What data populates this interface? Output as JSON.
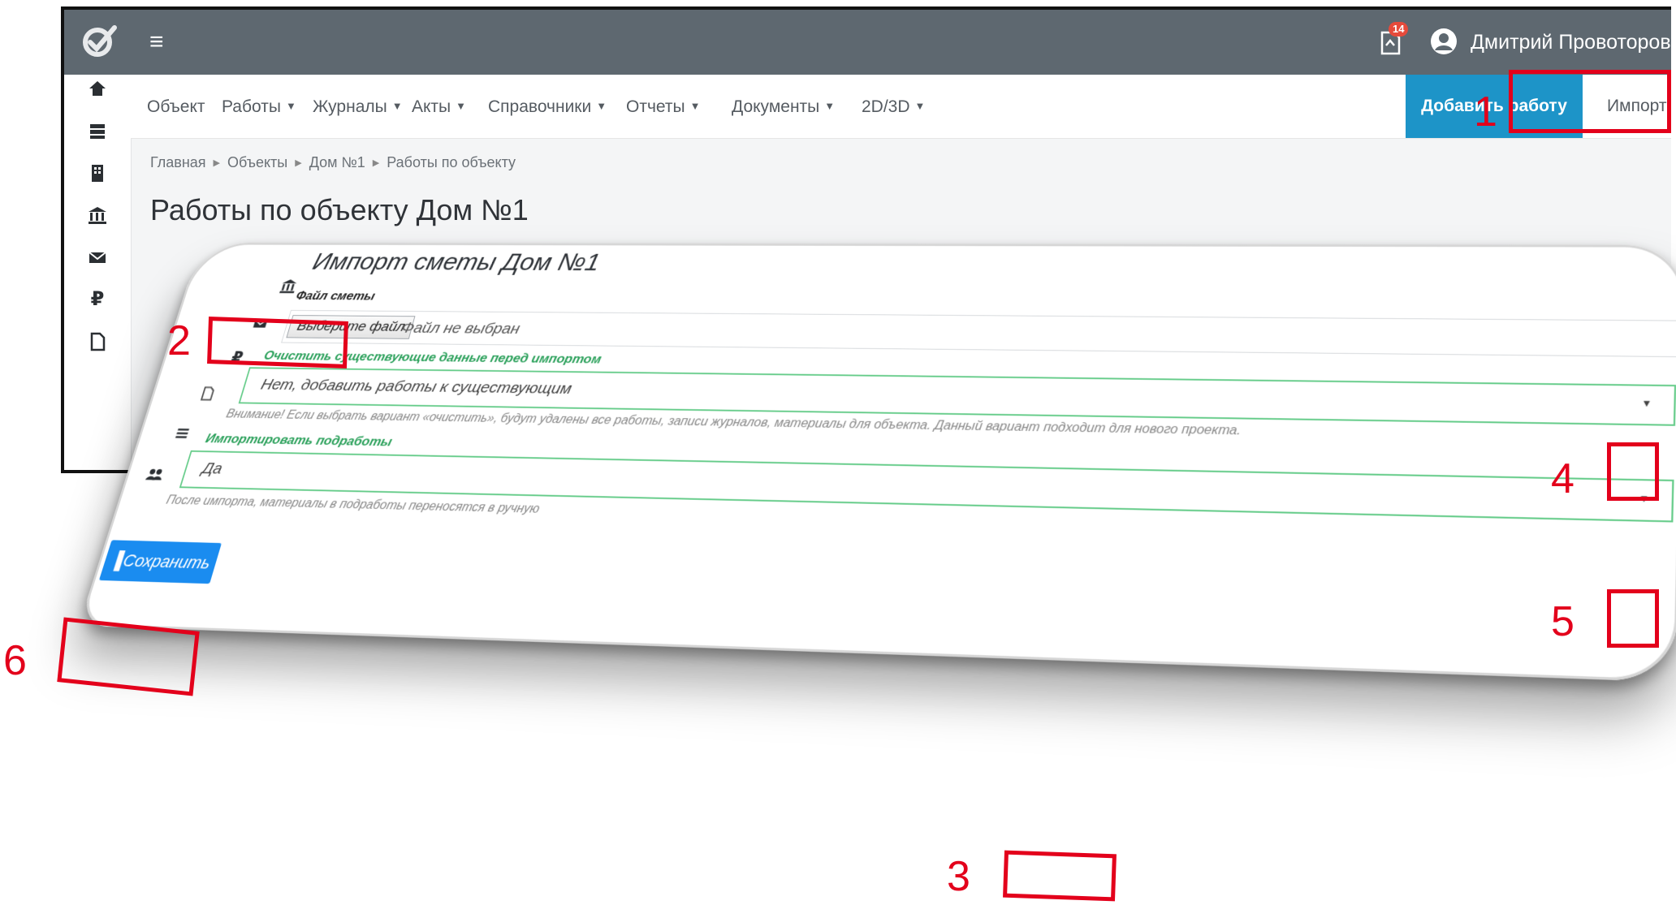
{
  "header": {
    "notification_count": "14",
    "user_name": "Дмитрий Провоторов"
  },
  "nav": {
    "items": [
      {
        "label": "Объект",
        "dropdown": false
      },
      {
        "label": "Работы",
        "dropdown": true
      },
      {
        "label": "Журналы",
        "dropdown": true
      },
      {
        "label": "Акты",
        "dropdown": true
      },
      {
        "label": "Справочники",
        "dropdown": true
      },
      {
        "label": "Отчеты",
        "dropdown": true
      },
      {
        "label": "Документы",
        "dropdown": true
      },
      {
        "label": "2D/3D",
        "dropdown": true
      }
    ],
    "add_button": "Добавить работу",
    "import_button": "Импорт сметы"
  },
  "breadcrumb": [
    "Главная",
    "Объекты",
    "Дом №1",
    "Работы по объекту"
  ],
  "page_title": "Работы по объекту Дом №1",
  "sidebar_icons": [
    "home-icon",
    "server-icon",
    "building-icon",
    "bank-icon",
    "envelope-icon",
    "ruble-icon",
    "document-icon"
  ],
  "modal": {
    "title": "Импорт сметы Дом №1",
    "file_label": "Файл сметы",
    "file_button": "Выберите файл",
    "file_status": "Файл не выбран",
    "clear_label": "Очистить существующие данные перед импортом",
    "clear_value": "Нет, добавить работы к существующим",
    "clear_hint": "Внимание! Если выбрать вариант «очистить», будут удалены все работы, записи журналов, материалы для объекта. Данный вариант подходит для нового проекта.",
    "subworks_label": "Импортировать подработы",
    "subworks_value": "Да",
    "subworks_hint": "После импорта, материалы в подработы переносятся в ручную",
    "save_button": "Сохранить"
  },
  "annotations": [
    "1",
    "2",
    "3",
    "4",
    "5",
    "6"
  ],
  "colors": {
    "topbar": "#5e6870",
    "primary": "#1d94c8",
    "save": "#1a8cf0",
    "annotation": "#e3001b",
    "success": "#2aa05a"
  }
}
